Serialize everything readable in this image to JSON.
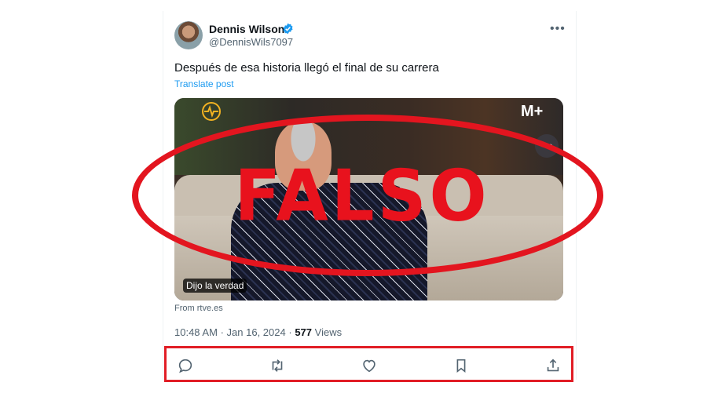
{
  "tweet": {
    "author_name": "Dennis Wilson",
    "handle": "@DennisWils7097",
    "text": "Después de esa historia llegó el final de su carrera",
    "translate_label": "Translate post",
    "more_label": "•••",
    "media": {
      "caption": "Dijo la verdad",
      "channel_logo": "M+",
      "more_label": "•••"
    },
    "source": "From rtve.es",
    "time": "10:48 AM",
    "date": "Jan 16, 2024",
    "views_count": "577",
    "views_label": "Views",
    "separator": "·"
  },
  "overlay": {
    "stamp_text": "FALSO",
    "color": "#e3151f"
  },
  "actions": [
    {
      "name": "reply-icon"
    },
    {
      "name": "repost-icon"
    },
    {
      "name": "like-icon"
    },
    {
      "name": "bookmark-icon"
    },
    {
      "name": "share-icon"
    }
  ]
}
